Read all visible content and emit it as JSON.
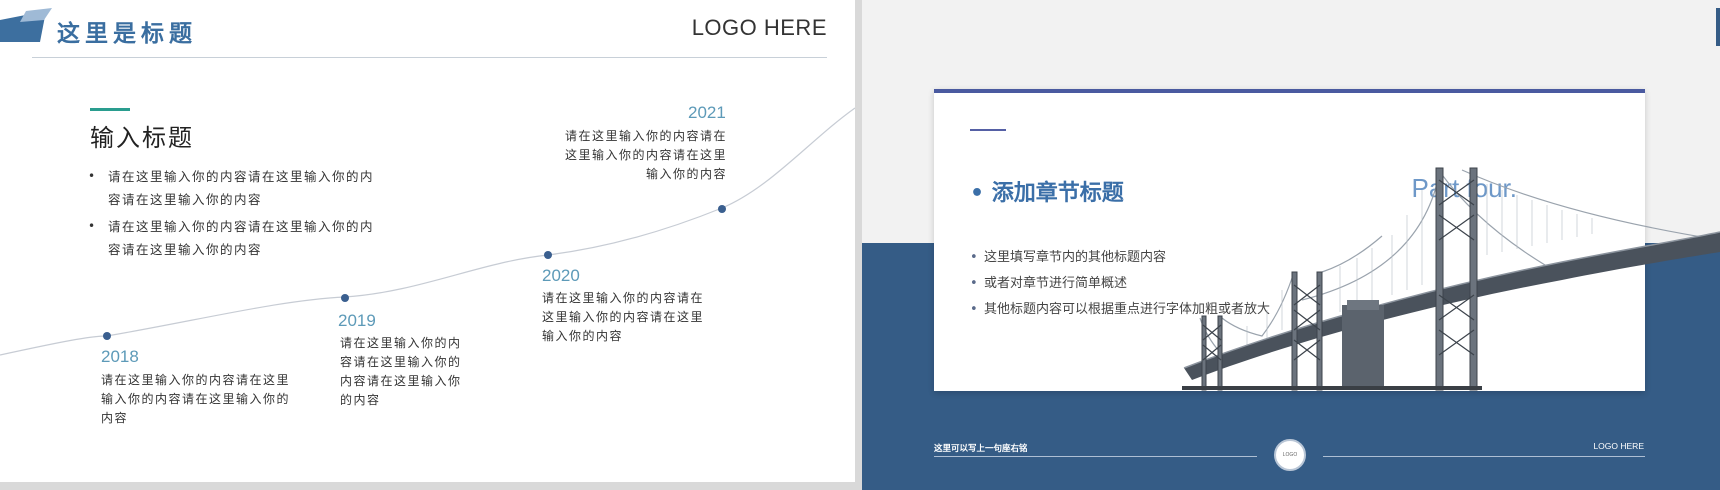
{
  "left_slide": {
    "header_title": "这里是标题",
    "logo": "LOGO HERE",
    "input_title": "输入标题",
    "bullets": [
      "请在这里输入你的内容请在这里输入你的内容请在这里输入你的内容",
      "请在这里输入你的内容请在这里输入你的内容请在这里输入你的内容"
    ],
    "timeline": [
      {
        "year": "2018",
        "lines": [
          "请在这里输入你的内容请在这里",
          "输入你的内容请在这里输入你的",
          "内容"
        ]
      },
      {
        "year": "2019",
        "lines": [
          "请在这里输入你的内",
          "容请在这里输入你的",
          "内容请在这里输入你",
          "的内容"
        ]
      },
      {
        "year": "2020",
        "lines": [
          "请在这里输入你的内容请在",
          "这里输入你的内容请在这里",
          "输入你的内容"
        ]
      },
      {
        "year": "2021",
        "lines": [
          "请在这里输入你的内容请在",
          "这里输入你的内容请在这里",
          "输入你的内容"
        ]
      }
    ]
  },
  "right_slide": {
    "chapter_title": "• 添加章节标题",
    "part_label": "Part four.",
    "items": [
      "这里填写章节内的其他标题内容",
      "或者对章节进行简单概述",
      "其他标题内容可以根据重点进行字体加粗或者放大"
    ],
    "footer_text": "这里可以写上一句座右铭",
    "logo_circle": "LOGO",
    "footer_logo": "LOGO HERE"
  },
  "colors": {
    "accent_blue": "#3a6ea0",
    "band_blue": "#355c86",
    "teal": "#2a9d8f",
    "timeline_dot": "#3a5f8f"
  },
  "icons": [
    "header-parallelogram-icon",
    "bridge-illustration"
  ]
}
